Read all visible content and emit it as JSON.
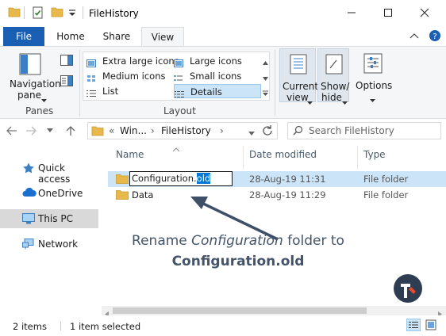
{
  "window": {
    "title": "FileHistory",
    "minimize_glyph": "—",
    "maximize_glyph": "☐",
    "close_glyph": "✕"
  },
  "ribbon_tabs": {
    "file": "File",
    "home": "Home",
    "share": "Share",
    "view": "View"
  },
  "ribbon": {
    "panes": {
      "navigation_pane_line1": "Navigation",
      "navigation_pane_line2": "pane",
      "group_label": "Panes"
    },
    "layout": {
      "group_label": "Layout",
      "items": [
        "Extra large icons",
        "Large icons",
        "Medium icons",
        "Small icons",
        "List",
        "Details"
      ],
      "selected": "Details"
    },
    "current_view": {
      "line1": "Current",
      "line2": "view"
    },
    "show_hide": {
      "line1": "Show/",
      "line2": "hide"
    },
    "options": {
      "label": "Options"
    }
  },
  "address": {
    "prefix": "«",
    "crumb1": "Win...",
    "crumb_sep": "›",
    "crumb2": "FileHistory",
    "crumb2_sep": "›",
    "search_placeholder": "Search FileHistory"
  },
  "nav_pane": {
    "items": [
      {
        "label": "Quick access",
        "icon": "star-icon"
      },
      {
        "label": "OneDrive",
        "icon": "cloud-icon"
      },
      {
        "label": "This PC",
        "icon": "computer-icon",
        "selected": true
      },
      {
        "label": "Network",
        "icon": "network-icon"
      }
    ]
  },
  "file_list": {
    "columns": [
      "Name",
      "Date modified",
      "Type"
    ],
    "rows": [
      {
        "name_base": "Configuration.",
        "name_selected": "old",
        "date": "28-Aug-19 11:31",
        "type": "File folder",
        "selected": true,
        "renaming": true
      },
      {
        "name": "Data",
        "date": "28-Aug-19 11:29",
        "type": "File folder",
        "selected": false
      }
    ]
  },
  "annotation": {
    "line1_prefix": "Rename ",
    "line1_italic": "Configuration",
    "line1_suffix": " folder to",
    "line2": "Configuration.old",
    "color": "#44546a"
  },
  "status": {
    "items_count": "2 items",
    "selected_count": "1 item selected"
  },
  "colors": {
    "file_tab": "#1a5fb4",
    "selection": "#cce4f7",
    "text_selection": "#0078d7",
    "folder": "#e8b84a"
  }
}
